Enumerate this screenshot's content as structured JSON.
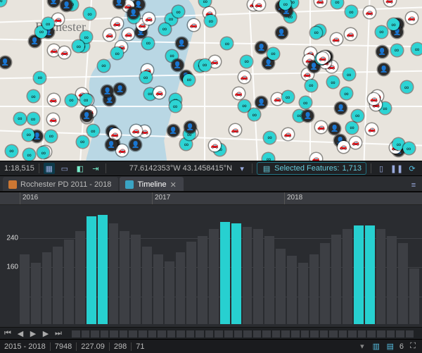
{
  "map": {
    "city_label": "Rochester"
  },
  "statusbar": {
    "scale": "1:18,515",
    "coords": "77.6142353°W 43.1458415°N",
    "selected_label": "Selected Features:",
    "selected_count": "1,713"
  },
  "tabs": {
    "items": [
      {
        "label": "Rochester PD 2011 - 2018",
        "active": false
      },
      {
        "label": "Timeline",
        "active": true
      }
    ]
  },
  "chart_data": {
    "type": "bar",
    "title": "",
    "xlabel": "",
    "ylabel": "",
    "ylim": [
      0,
      320
    ],
    "year_labels": [
      "2016",
      "2017",
      "2018"
    ],
    "yticks": [
      160,
      240
    ],
    "categories": [
      "2016-01",
      "2016-02",
      "2016-03",
      "2016-04",
      "2016-05",
      "2016-06",
      "2016-07",
      "2016-08",
      "2016-09",
      "2016-10",
      "2016-11",
      "2016-12",
      "2017-01",
      "2017-02",
      "2017-03",
      "2017-04",
      "2017-05",
      "2017-06",
      "2017-07",
      "2017-08",
      "2017-09",
      "2017-10",
      "2017-11",
      "2017-12",
      "2018-01",
      "2018-02",
      "2018-03",
      "2018-04",
      "2018-05",
      "2018-06",
      "2018-07",
      "2018-08",
      "2018-09",
      "2018-10",
      "2018-11",
      "2018-12"
    ],
    "values": [
      195,
      170,
      200,
      215,
      235,
      260,
      300,
      305,
      280,
      260,
      250,
      215,
      195,
      175,
      200,
      230,
      245,
      265,
      285,
      280,
      270,
      265,
      245,
      210,
      190,
      170,
      195,
      225,
      250,
      265,
      275,
      275,
      265,
      245,
      225,
      155
    ],
    "selected_indices": [
      6,
      7,
      18,
      19,
      30,
      31
    ]
  },
  "playbar": {
    "visible_count": "6"
  },
  "footer": {
    "range": "2015 - 2018",
    "stat1": "7948",
    "stat2": "227.09",
    "stat3": "298",
    "stat4": "71"
  }
}
